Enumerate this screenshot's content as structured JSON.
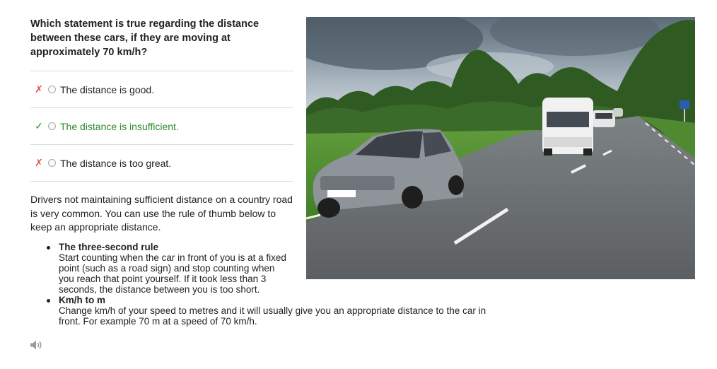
{
  "question": "Which statement is true regarding the distance between these cars, if they are moving at approximately 70 km/h?",
  "answers": [
    {
      "mark": "✗",
      "label": "The distance is good.",
      "state": "wrong"
    },
    {
      "mark": "✓",
      "label": "The distance is insufficient.",
      "state": "correct"
    },
    {
      "mark": "✗",
      "label": "The distance is too great.",
      "state": "wrong"
    }
  ],
  "explanation": "Drivers not maintaining sufficient distance on a country road is very common. You can use the rule of thumb below to keep an appropriate distance.",
  "rules": [
    {
      "title": "The three-second rule",
      "text": "Start counting when the car in front of you is at a fixed point (such as a road sign) and stop counting when you reach that point yourself. If it took less than 3 seconds, the distance between you is too short."
    },
    {
      "title": "Km/h to m",
      "text": "Change km/h of your speed to metres and it will usually give you an appropriate distance to the car in front. For example 70 m at a speed of 70 km/h."
    }
  ],
  "icons": {
    "audio": "speaker-icon",
    "photo": "country-road-cars-photo"
  },
  "colors": {
    "correct": "#2e8b2e",
    "wrong": "#d9534f",
    "divider": "#dcdcdc"
  }
}
